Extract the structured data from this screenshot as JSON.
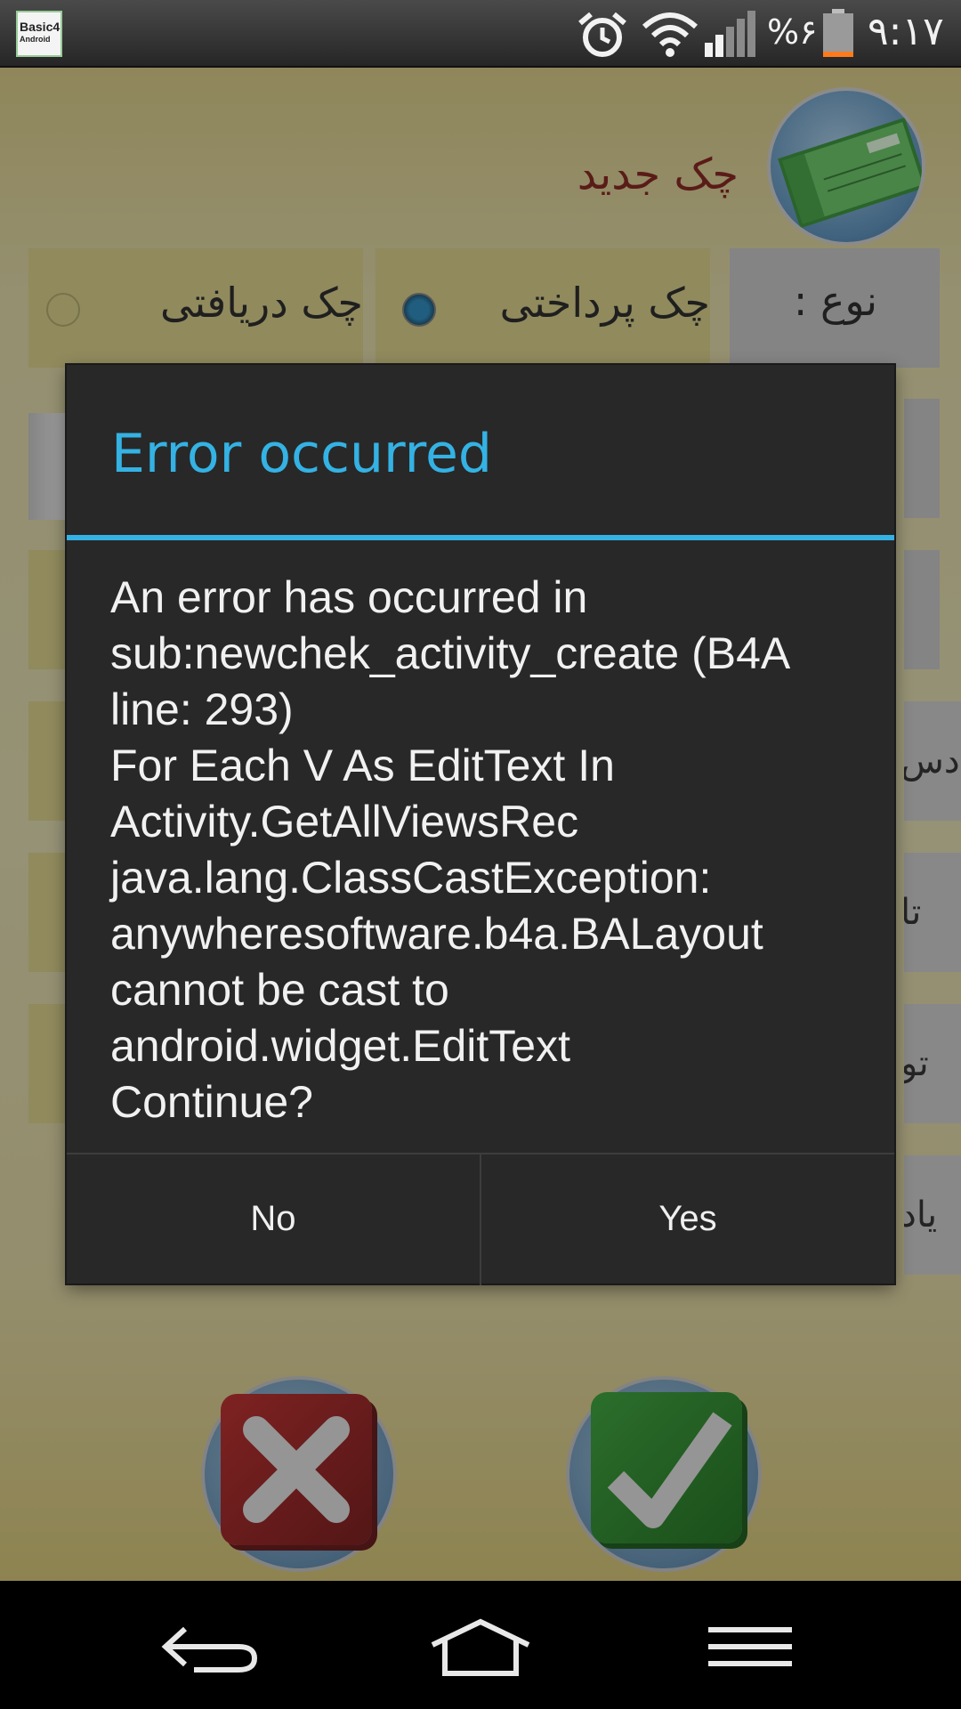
{
  "status_bar": {
    "time": "٩:١٧",
    "battery_percent": "%۶",
    "battery_level": 0.06,
    "app_logo_text": "Basic4",
    "app_logo_sub": "Android",
    "icons": [
      "alarm-icon",
      "wifi-icon",
      "signal-icon",
      "battery-icon"
    ]
  },
  "screen": {
    "title": "چک جدید",
    "type_label": "نوع :",
    "option_paid": "چک پرداختی",
    "option_received": "چک دریافتی",
    "selected_option": "option_paid",
    "edge_labels": [
      "دس",
      "تا",
      "تو",
      "یاد"
    ]
  },
  "dialog": {
    "title": "Error occurred",
    "message": "An error has occurred in\nsub:newchek_activity_create (B4A\nline: 293)\nFor Each V As EditText In\nActivity.GetAllViewsRec\njava.lang.ClassCastException:\nanywheresoftware.b4a.BALayout\ncannot be cast to\nandroid.widget.EditText\nContinue?",
    "no_label": "No",
    "yes_label": "Yes"
  },
  "actions": {
    "cancel_icon": "close-icon",
    "confirm_icon": "checkmark-icon"
  },
  "nav_bar": {
    "icons": [
      "back-icon",
      "home-icon",
      "menu-icon"
    ]
  },
  "colors": {
    "accent": "#34b2e4",
    "dialog_bg": "#282828",
    "title_red": "#7a1610"
  }
}
